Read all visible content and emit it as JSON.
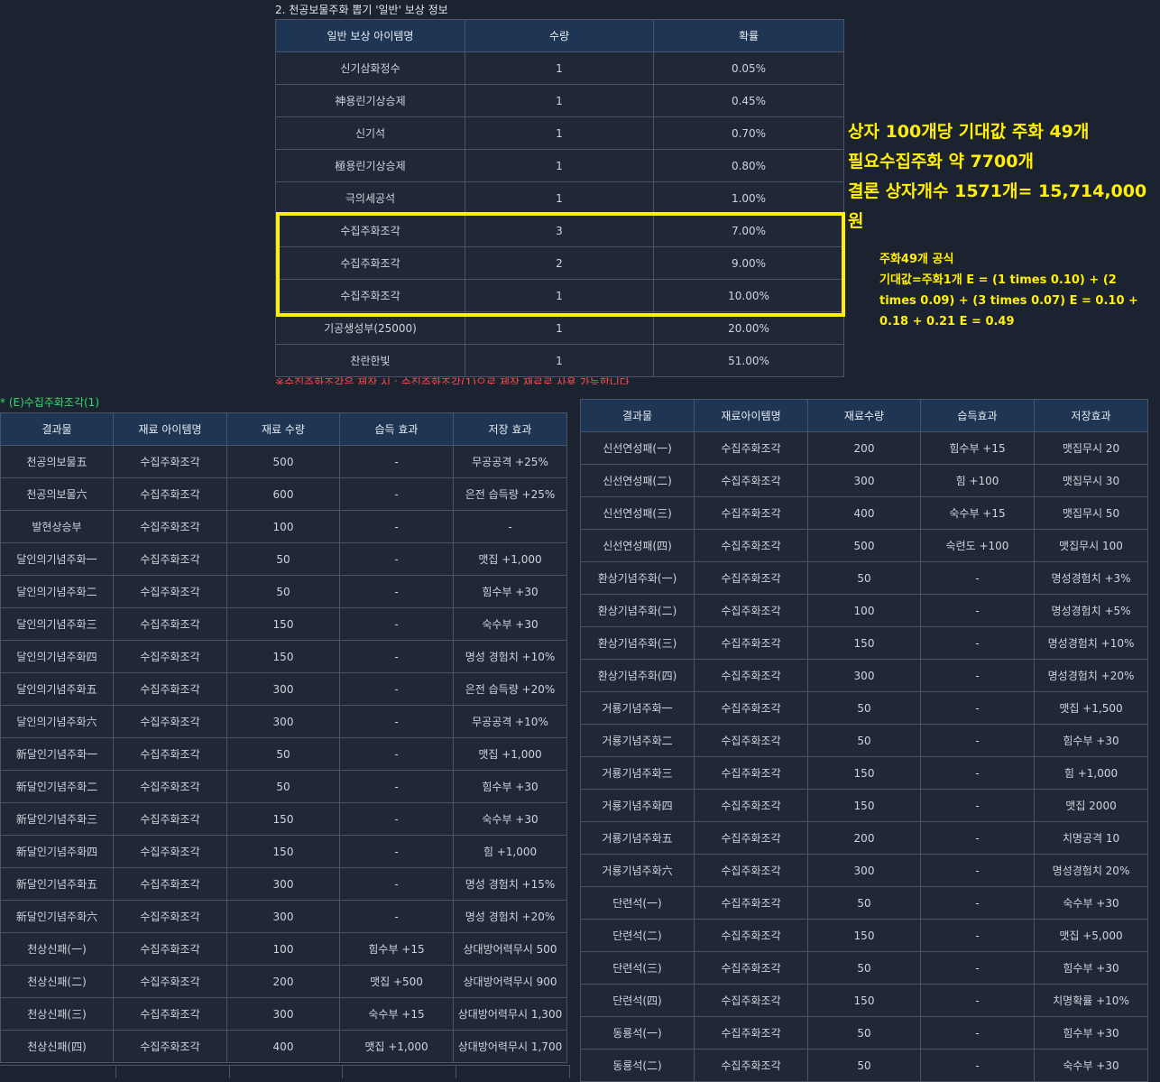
{
  "top": {
    "title": "2. 천공보물주화 뽑기 '일반' 보상 정보",
    "headers": [
      "일반 보상 아이템명",
      "수량",
      "확률"
    ],
    "rows": [
      [
        "신기삼화정수",
        "1",
        "0.05%"
      ],
      [
        "神용린기상승제",
        "1",
        "0.45%"
      ],
      [
        "신기석",
        "1",
        "0.70%"
      ],
      [
        "極용린기상승제",
        "1",
        "0.80%"
      ],
      [
        "극의세공석",
        "1",
        "1.00%"
      ],
      [
        "수집주화조각",
        "3",
        "7.00%"
      ],
      [
        "수집주화조각",
        "2",
        "9.00%"
      ],
      [
        "수집주화조각",
        "1",
        "10.00%"
      ],
      [
        "기공생성부(25000)",
        "1",
        "20.00%"
      ],
      [
        "찬란한빛",
        "1",
        "51.00%"
      ]
    ],
    "note": "※수집주화조각은 제작 시 ; 수집주화조각(1)으로 제작 재료로 사용 가능합니다"
  },
  "summary": {
    "line1": "상자 100개당 기대값 주화 49개",
    "line2": "필요수집주화 약 7700개",
    "line3": "결론 상자개수 1571개= 15,714,000원"
  },
  "formula": {
    "line1": "주화49개 공식",
    "line2": "기대값=주화1개 E = (1 times 0.10) + (2 times 0.09) + (3 times 0.07) E = 0.10 + 0.18 + 0.21 E = 0.49"
  },
  "left": {
    "caption": "* (E)수집주화조각(1)",
    "headers": [
      "결과물",
      "재료 아이템명",
      "재료 수량",
      "습득 효과",
      "저장 효과"
    ],
    "rows": [
      [
        "천공의보물五",
        "수집주화조각",
        "500",
        "-",
        "무공공격 +25%"
      ],
      [
        "천공의보물六",
        "수집주화조각",
        "600",
        "-",
        "은전 습득량 +25%"
      ],
      [
        "발현상승부",
        "수집주화조각",
        "100",
        "-",
        "-"
      ],
      [
        "달인의기념주화一",
        "수집주화조각",
        "50",
        "-",
        "맷집 +1,000"
      ],
      [
        "달인의기념주화二",
        "수집주화조각",
        "50",
        "-",
        "힘수부 +30"
      ],
      [
        "달인의기념주화三",
        "수집주화조각",
        "150",
        "-",
        "숙수부 +30"
      ],
      [
        "달인의기념주화四",
        "수집주화조각",
        "150",
        "-",
        "명성 경험치 +10%"
      ],
      [
        "달인의기념주화五",
        "수집주화조각",
        "300",
        "-",
        "은전 습득량 +20%"
      ],
      [
        "달인의기념주화六",
        "수집주화조각",
        "300",
        "-",
        "무공공격 +10%"
      ],
      [
        "新달인기념주화一",
        "수집주화조각",
        "50",
        "-",
        "맷집 +1,000"
      ],
      [
        "新달인기념주화二",
        "수집주화조각",
        "50",
        "-",
        "힘수부 +30"
      ],
      [
        "新달인기념주화三",
        "수집주화조각",
        "150",
        "-",
        "숙수부 +30"
      ],
      [
        "新달인기념주화四",
        "수집주화조각",
        "150",
        "-",
        "힘 +1,000"
      ],
      [
        "新달인기념주화五",
        "수집주화조각",
        "300",
        "-",
        "명성 경험치 +15%"
      ],
      [
        "新달인기념주화六",
        "수집주화조각",
        "300",
        "-",
        "명성 경험치 +20%"
      ],
      [
        "천상신패(一)",
        "수집주화조각",
        "100",
        "힘수부 +15",
        "상대방어력무시 500"
      ],
      [
        "천상신패(二)",
        "수집주화조각",
        "200",
        "맷집 +500",
        "상대방어력무시 900"
      ],
      [
        "천상신패(三)",
        "수집주화조각",
        "300",
        "숙수부 +15",
        "상대방어력무시 1,300"
      ],
      [
        "천상신패(四)",
        "수집주화조각",
        "400",
        "맷집 +1,000",
        "상대방어력무시 1,700"
      ]
    ]
  },
  "right": {
    "headers": [
      "결과물",
      "재료아이템명",
      "재료수량",
      "습득효과",
      "저장효과"
    ],
    "rows": [
      [
        "신선연성패(一)",
        "수집주화조각",
        "200",
        "힘수부 +15",
        "맷집무시 20"
      ],
      [
        "신선연성패(二)",
        "수집주화조각",
        "300",
        "힘 +100",
        "맷집무시 30"
      ],
      [
        "신선연성패(三)",
        "수집주화조각",
        "400",
        "숙수부 +15",
        "맷집무시 50"
      ],
      [
        "신선연성패(四)",
        "수집주화조각",
        "500",
        "숙련도 +100",
        "맷집무시 100"
      ],
      [
        "환상기념주화(一)",
        "수집주화조각",
        "50",
        "-",
        "명성경험치 +3%"
      ],
      [
        "환상기념주화(二)",
        "수집주화조각",
        "100",
        "-",
        "명성경험치 +5%"
      ],
      [
        "환상기념주화(三)",
        "수집주화조각",
        "150",
        "-",
        "명성경험치 +10%"
      ],
      [
        "환상기념주화(四)",
        "수집주화조각",
        "300",
        "-",
        "명성경험치 +20%"
      ],
      [
        "거룡기념주화一",
        "수집주화조각",
        "50",
        "-",
        "맷집 +1,500"
      ],
      [
        "거룡기념주화二",
        "수집주화조각",
        "50",
        "-",
        "힘수부 +30"
      ],
      [
        "거룡기념주화三",
        "수집주화조각",
        "150",
        "-",
        "힘 +1,000"
      ],
      [
        "거룡기념주화四",
        "수집주화조각",
        "150",
        "-",
        "맷집 2000"
      ],
      [
        "거룡기념주화五",
        "수집주화조각",
        "200",
        "-",
        "치명공격 10"
      ],
      [
        "거룡기념주화六",
        "수집주화조각",
        "300",
        "-",
        "명성경험치 20%"
      ],
      [
        "단련석(一)",
        "수집주화조각",
        "50",
        "-",
        "숙수부 +30"
      ],
      [
        "단련석(二)",
        "수집주화조각",
        "150",
        "-",
        "맷집 +5,000"
      ],
      [
        "단련석(三)",
        "수집주화조각",
        "50",
        "-",
        "힘수부 +30"
      ],
      [
        "단련석(四)",
        "수집주화조각",
        "150",
        "-",
        "치명확률 +10%"
      ],
      [
        "동룡석(一)",
        "수집주화조각",
        "50",
        "-",
        "힘수부 +30"
      ],
      [
        "동룡석(二)",
        "수집주화조각",
        "50",
        "-",
        "숙수부 +30"
      ]
    ]
  }
}
